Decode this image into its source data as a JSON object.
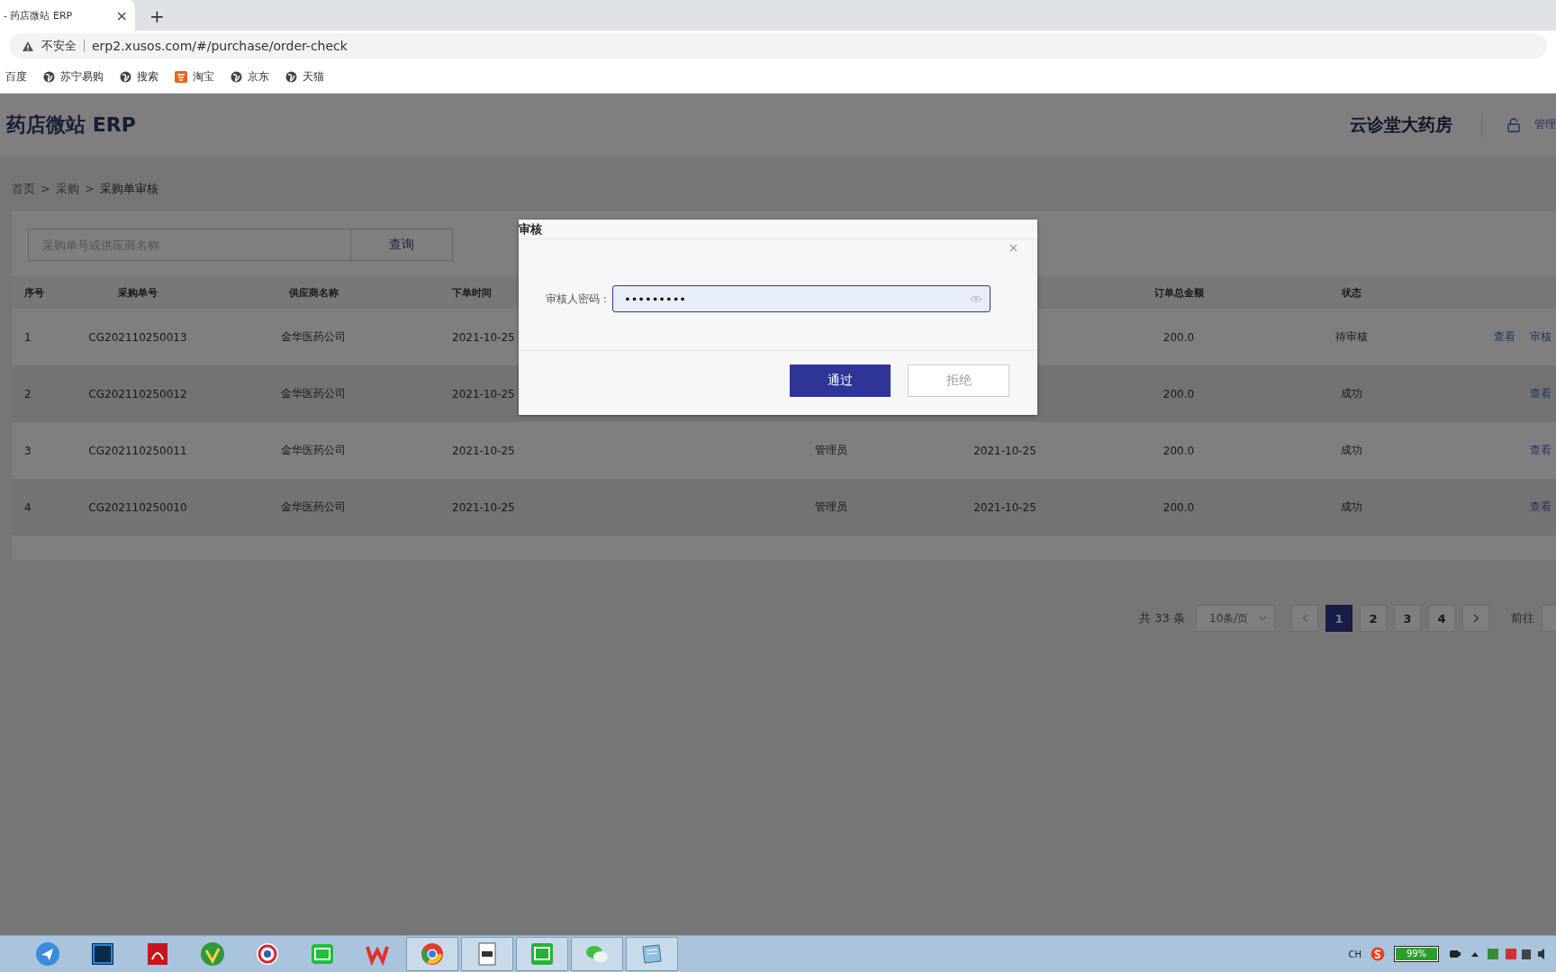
{
  "browser": {
    "tab_title": "- 药店微站 ERP",
    "close_tab": "×",
    "new_tab": "+",
    "security_label": "不安全",
    "url": "erp2.xusos.com/#/purchase/order-check",
    "bookmarks": [
      {
        "label": "百度",
        "kind": "none"
      },
      {
        "label": "苏宁易购",
        "kind": "globe"
      },
      {
        "label": "搜索",
        "kind": "globe"
      },
      {
        "label": "淘宝",
        "kind": "shop"
      },
      {
        "label": "京东",
        "kind": "globe"
      },
      {
        "label": "天猫",
        "kind": "globe"
      }
    ]
  },
  "header": {
    "app_title": "药店微站 ERP",
    "store_name": "云诊堂大药房",
    "user": "管理"
  },
  "breadcrumb": {
    "separator": ">",
    "items": [
      "首页",
      "采购",
      "采购单审核"
    ]
  },
  "search": {
    "placeholder": "采购单号或供应商名称",
    "button": "查询"
  },
  "table": {
    "columns": [
      {
        "label": "序号"
      },
      {
        "label": "采购单号"
      },
      {
        "label": "供应商名称"
      },
      {
        "label": "下单时间"
      },
      {},
      {},
      {
        "label": "订单总金额"
      },
      {
        "label": "状态"
      },
      {}
    ],
    "rows": [
      {
        "cells": [
          "1",
          "CG202110250013",
          "金华医药公司",
          "2021-10-25",
          "",
          "",
          "200.0",
          "待审核"
        ],
        "actions": [
          "查看",
          "审核"
        ]
      },
      {
        "cells": [
          "2",
          "CG202110250012",
          "金华医药公司",
          "2021-10-25",
          "",
          "",
          "200.0",
          "成功"
        ],
        "actions": [
          "查看"
        ]
      },
      {
        "cells": [
          "3",
          "CG202110250011",
          "金华医药公司",
          "2021-10-25",
          "管理员",
          "2021-10-25",
          "200.0",
          "成功"
        ],
        "actions": [
          "查看"
        ]
      },
      {
        "cells": [
          "4",
          "CG202110250010",
          "金华医药公司",
          "2021-10-25",
          "管理员",
          "2021-10-25",
          "200.0",
          "成功"
        ],
        "actions": [
          "查看"
        ]
      }
    ]
  },
  "pagination": {
    "total": "共 33 条",
    "page_size": "10条/页",
    "pages": [
      {
        "label": "1",
        "selected": true
      },
      {
        "label": "2",
        "selected": false
      },
      {
        "label": "3",
        "selected": false
      },
      {
        "label": "4",
        "selected": false
      }
    ],
    "goto": "前往"
  },
  "dialog": {
    "title": "审核",
    "field_label": "审核人密码：",
    "value": "•••••••••",
    "approve": "通过",
    "reject": "拒绝"
  },
  "taskbar": {
    "apps": [
      {
        "kind": "bird",
        "open": false
      },
      {
        "kind": "ps",
        "open": false
      },
      {
        "kind": "pdf",
        "open": false
      },
      {
        "kind": "leaf",
        "open": false
      },
      {
        "kind": "ring",
        "open": false
      },
      {
        "kind": "video",
        "open": false
      },
      {
        "kind": "office",
        "open": false
      },
      {
        "kind": "browser",
        "open": true
      },
      {
        "kind": "doc",
        "open": true
      },
      {
        "kind": "screen",
        "open": true
      },
      {
        "kind": "chat",
        "open": true
      },
      {
        "kind": "note",
        "open": true
      }
    ],
    "language": "CH",
    "battery": "99%"
  }
}
